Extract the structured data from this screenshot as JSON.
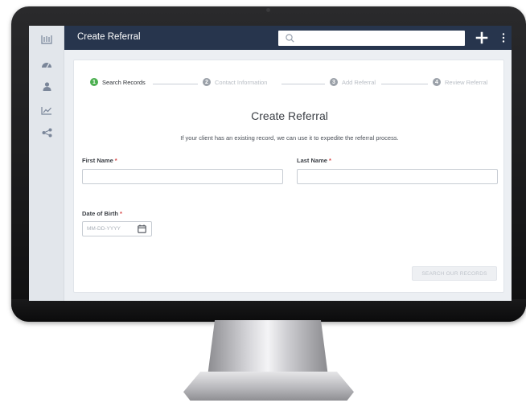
{
  "colors": {
    "topbar": "#27354d",
    "step_active": "#4caf50",
    "step_inactive": "#9aa0a8",
    "required": "#d64545"
  },
  "sidebar": {
    "items": [
      {
        "icon": "logo-icon"
      },
      {
        "icon": "dashboard-gauge-icon"
      },
      {
        "icon": "user-icon"
      },
      {
        "icon": "line-chart-icon"
      },
      {
        "icon": "share-icon"
      }
    ]
  },
  "topbar": {
    "title": "Create Referral",
    "search_placeholder": "",
    "search_icon": "search-icon",
    "add_icon": "plus-icon",
    "more_icon": "more-vertical-icon"
  },
  "stepper": {
    "steps": [
      {
        "number": "1",
        "label": "Search Records",
        "state": "active"
      },
      {
        "number": "2",
        "label": "Contact Information",
        "state": "inactive"
      },
      {
        "number": "3",
        "label": "Add Referral",
        "state": "inactive"
      },
      {
        "number": "4",
        "label": "Review Referral",
        "state": "inactive"
      }
    ]
  },
  "form": {
    "title": "Create Referral",
    "subtitle": "If your client has an existing record, we can use it to expedite the referral process.",
    "first_name_label": "First Name",
    "last_name_label": "Last Name",
    "dob_label": "Date of Birth",
    "required_mark": "*",
    "first_name_value": "",
    "last_name_value": "",
    "dob_placeholder": "MM-DD-YYYY",
    "submit_label": "SEARCH OUR RECORDS"
  }
}
